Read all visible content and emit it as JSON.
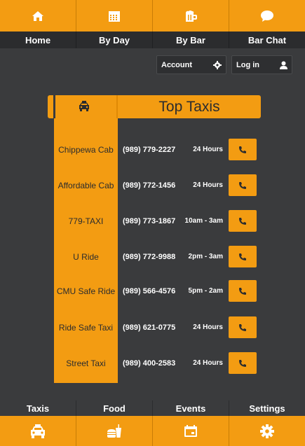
{
  "top_nav": {
    "items": [
      {
        "label": "Home",
        "icon": "home-icon"
      },
      {
        "label": "By Day",
        "icon": "calendar-icon"
      },
      {
        "label": "By Bar",
        "icon": "beer-mug-icon"
      },
      {
        "label": "Bar Chat",
        "icon": "chat-bubble-icon"
      }
    ]
  },
  "account": {
    "account_label": "Account",
    "login_label": "Log in"
  },
  "page": {
    "title": "Top Taxis"
  },
  "taxis": [
    {
      "name": "Chippewa Cab",
      "phone": "(989) 779-2227",
      "hours": "24 Hours"
    },
    {
      "name": "Affordable Cab",
      "phone": "(989) 772-1456",
      "hours": "24 Hours"
    },
    {
      "name": "779-TAXI",
      "phone": "(989) 773-1867",
      "hours": "10am - 3am"
    },
    {
      "name": "U Ride",
      "phone": "(989) 772-9988",
      "hours": "2pm - 3am"
    },
    {
      "name": "CMU Safe Ride",
      "phone": "(989) 566-4576",
      "hours": "5pm - 2am"
    },
    {
      "name": "Ride Safe Taxi",
      "phone": "(989) 621-0775",
      "hours": "24 Hours"
    },
    {
      "name": "Street Taxi",
      "phone": "(989) 400-2583",
      "hours": "24 Hours"
    }
  ],
  "bottom_nav": {
    "items": [
      {
        "label": "Taxis",
        "icon": "taxi-icon"
      },
      {
        "label": "Food",
        "icon": "food-icon"
      },
      {
        "label": "Events",
        "icon": "events-calendar-icon"
      },
      {
        "label": "Settings",
        "icon": "gear-icon"
      }
    ]
  },
  "colors": {
    "accent": "#f39c12",
    "background": "#3a3b3d",
    "bar_dark": "#2b2c2e"
  }
}
